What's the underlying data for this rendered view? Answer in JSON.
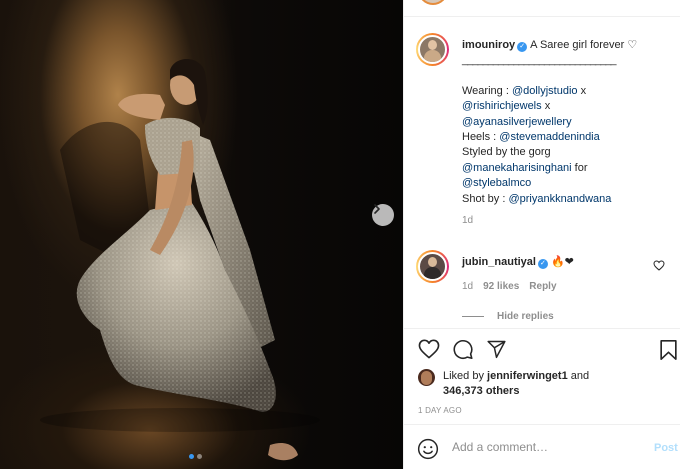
{
  "photo": {
    "alt_icon": "chevron-right-icon",
    "carousel_total": 2,
    "carousel_active": 1
  },
  "caption": {
    "username": "imouniroy",
    "verified_icon": "verified-badge-icon",
    "headline": "A Saree girl forever",
    "heart": "♡",
    "rule": "______________________________",
    "lines": [
      {
        "prefix": "Wearing : ",
        "mention": "@dollyjstudio",
        "suffix": " x"
      },
      {
        "prefix": "",
        "mention": "@rishirichjewels",
        "suffix": " x"
      },
      {
        "prefix": "",
        "mention": "@ayanasilverjewellery",
        "suffix": ""
      },
      {
        "prefix": "Heels : ",
        "mention": "@stevemaddenindia",
        "suffix": ""
      },
      {
        "prefix": "Styled by the gorg",
        "mention": "",
        "suffix": ""
      },
      {
        "prefix": "",
        "mention": "@manekaharisinghani",
        "suffix": " for"
      },
      {
        "prefix": "",
        "mention": "@stylebalmco",
        "suffix": ""
      },
      {
        "prefix": "Shot by : ",
        "mention": "@priyankknandwana",
        "suffix": ""
      }
    ],
    "time": "1d"
  },
  "comment": {
    "username": "jubin_nautiyal",
    "emoji": "🔥❤",
    "time": "1d",
    "likes": "92 likes",
    "reply": "Reply",
    "hide_replies": "Hide replies"
  },
  "actions": {
    "like_icon": "heart-icon",
    "comment_icon": "comment-icon",
    "share_icon": "share-icon",
    "save_icon": "bookmark-icon"
  },
  "likes": {
    "prefix": "Liked by ",
    "user": "jenniferwinget1",
    "and": " and",
    "others": "346,373 others"
  },
  "post_time": "1 DAY AGO",
  "add_comment": {
    "placeholder": "Add a comment…",
    "post": "Post"
  },
  "colors": {
    "verified": "#3897f0",
    "link": "#00376b",
    "post_disabled": "#b2dffc",
    "muted": "#8e8e8e"
  }
}
